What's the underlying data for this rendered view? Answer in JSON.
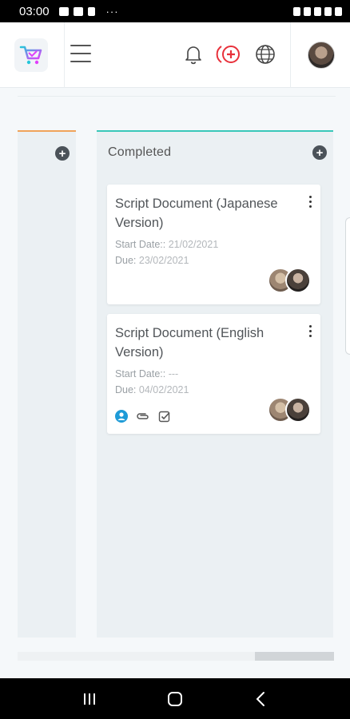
{
  "status_bar": {
    "time": "03:00",
    "more": "···"
  },
  "header": {
    "logo_icon": "shopping-cart-icon",
    "menu_icon": "hamburger-icon",
    "bell_icon": "bell-icon",
    "add_icon": "add-circle-icon",
    "globe_icon": "globe-icon",
    "accent_color": "#e8313b"
  },
  "board": {
    "columns": [
      {
        "title": "",
        "accent": "#f0a35a"
      },
      {
        "title": "Completed",
        "accent": "#3ac7b9",
        "cards": [
          {
            "title": "Script Document (Japanese Version)",
            "start_label": "Start Date::",
            "start_value": "21/02/2021",
            "due_label": "Due:",
            "due_value": "23/02/2021"
          },
          {
            "title": "Script Document (English Version)",
            "start_label": "Start Date::",
            "start_value": "---",
            "due_label": "Due:",
            "due_value": "04/02/2021",
            "tools": [
              "user-circle-icon",
              "paperclip-icon",
              "checkbox-icon"
            ]
          }
        ]
      }
    ],
    "add_symbol": "+"
  }
}
